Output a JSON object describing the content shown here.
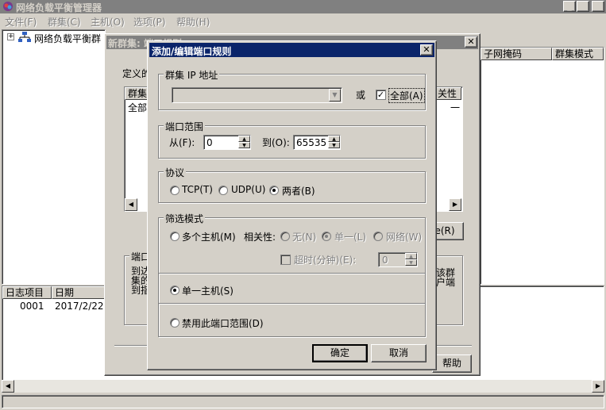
{
  "app": {
    "title": "网络负载平衡管理器",
    "menu": [
      "文件(F)",
      "群集(C)",
      "主机(O)",
      "选项(P)",
      "帮助(H)"
    ]
  },
  "tree": {
    "root_label": "网络负载平衡群"
  },
  "right_headers": {
    "col1": "子网掩码",
    "col2": "群集模式"
  },
  "log": {
    "headers": [
      "日志项目",
      "日期"
    ],
    "rows": [
      {
        "item": "0001",
        "date": "2017/2/22"
      }
    ]
  },
  "back_dialog": {
    "title": "新群集: 端口规则",
    "define_label": "定义的",
    "list_header_1": "群集",
    "list_header_2": "关性",
    "list_row_1": "全部",
    "list_row_2": "一",
    "remove_btn_suffix": "e(R)",
    "group_title": "端口",
    "desc_lines": [
      "到达",
      "集的",
      "到指"
    ],
    "desc_right": [
      "该群",
      "户端"
    ],
    "help_btn": "帮助"
  },
  "dialog": {
    "title": "添加/编辑端口规则",
    "cluster_ip_group": "群集 IP 地址",
    "or_label": "或",
    "all_label": "全部(A)",
    "all_checked": true,
    "port_range_group": "端口范围",
    "from_label": "从(F):",
    "from_value": "0",
    "to_label": "到(O):",
    "to_value": "65535",
    "protocol_group": "协议",
    "protocols": [
      "TCP(T)",
      "UDP(U)",
      "两者(B)"
    ],
    "protocol_selected": "两者(B)",
    "filter_group": "筛选模式",
    "multi_host": "多个主机(M)",
    "affinity_label": "相关性:",
    "affinity_options": [
      "无(N)",
      "单一(L)",
      "网络(W)"
    ],
    "affinity_selected": "单一(L)",
    "timeout_label": "超时(分钟)(E):",
    "timeout_value": "0",
    "single_host": "单一主机(S)",
    "disable_range": "禁用此端口范围(D)",
    "filter_selected": "单一主机(S)",
    "ok": "确定",
    "cancel": "取消"
  },
  "colors": {
    "active_title": "#0a246a",
    "inactive_title": "#808080",
    "face": "#d4d0c8"
  }
}
